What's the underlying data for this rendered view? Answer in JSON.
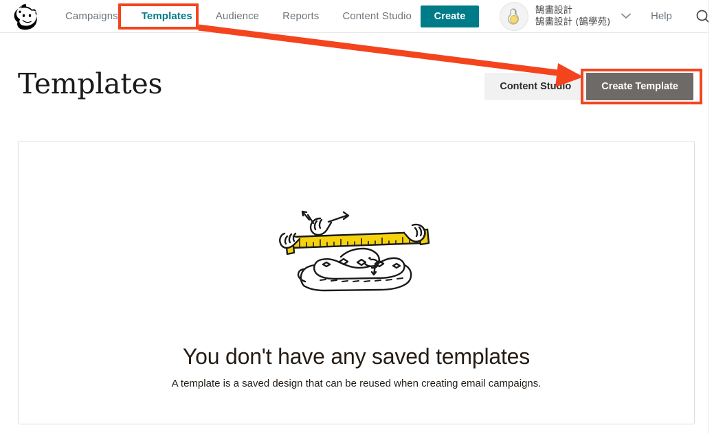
{
  "header": {
    "logo_name": "mailchimp-freddie-logo",
    "nav": [
      {
        "label": "Campaigns",
        "active": false
      },
      {
        "label": "Templates",
        "active": true
      },
      {
        "label": "Audience",
        "active": false
      },
      {
        "label": "Reports",
        "active": false
      },
      {
        "label": "Content Studio",
        "active": false
      }
    ],
    "create_button": "Create",
    "account": {
      "name": "鵠畵設計",
      "org": "鵠畵設計 (鵠學苑)",
      "avatar_icon": "user-avatar-icon",
      "chevron": "⌄"
    },
    "help_label": "Help",
    "search_icon": "search-icon"
  },
  "page": {
    "title": "Templates",
    "content_studio_button": "Content Studio",
    "create_template_button": "Create Template"
  },
  "empty_state": {
    "illustration_name": "snake-measuring-tape-illustration",
    "title": "You don't have any saved templates",
    "subtitle": "A template is a saved design that can be reused when creating email campaigns."
  },
  "annotations": {
    "highlight_color": "#f4441e",
    "arrow_name": "annotation-arrow-templates-to-create-template",
    "box_tab_name": "annotation-box-templates-tab",
    "box_button_name": "annotation-box-create-template"
  },
  "colors": {
    "brand_teal": "#007c89",
    "create_template_gray": "#6e6a67",
    "content_studio_gray": "#f1f1f1",
    "annotation_red": "#f4441e",
    "illustration_yellow": "#f5d20c"
  }
}
